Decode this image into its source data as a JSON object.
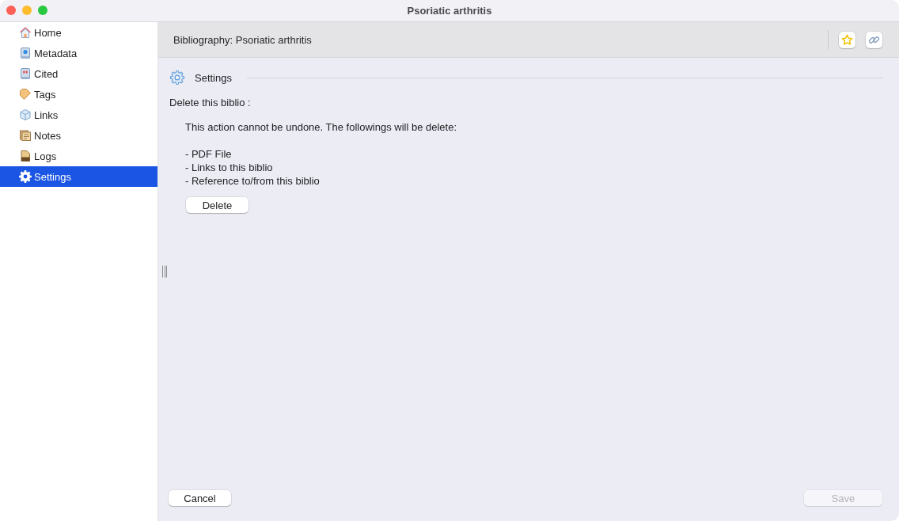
{
  "window": {
    "title": "Psoriatic arthritis"
  },
  "sidebar": {
    "items": [
      {
        "label": "Home",
        "selected": false
      },
      {
        "label": "Metadata",
        "selected": false
      },
      {
        "label": "Cited",
        "selected": false
      },
      {
        "label": "Tags",
        "selected": false
      },
      {
        "label": "Links",
        "selected": false
      },
      {
        "label": "Notes",
        "selected": false
      },
      {
        "label": "Logs",
        "selected": false
      },
      {
        "label": "Settings",
        "selected": true
      }
    ]
  },
  "header": {
    "title": "Bibliography: Psoriatic arthritis"
  },
  "settings": {
    "title": "Settings",
    "delete_label": "Delete this biblio :",
    "warning": "This action cannot be undone. The followings will be delete:",
    "items": [
      "- PDF File",
      "- Links to this biblio",
      "- Reference to/from this biblio"
    ],
    "delete_button": "Delete"
  },
  "footer": {
    "buttons": [
      {
        "label": "Cancel",
        "disabled": false
      },
      {
        "label": "Save",
        "disabled": true
      }
    ]
  }
}
